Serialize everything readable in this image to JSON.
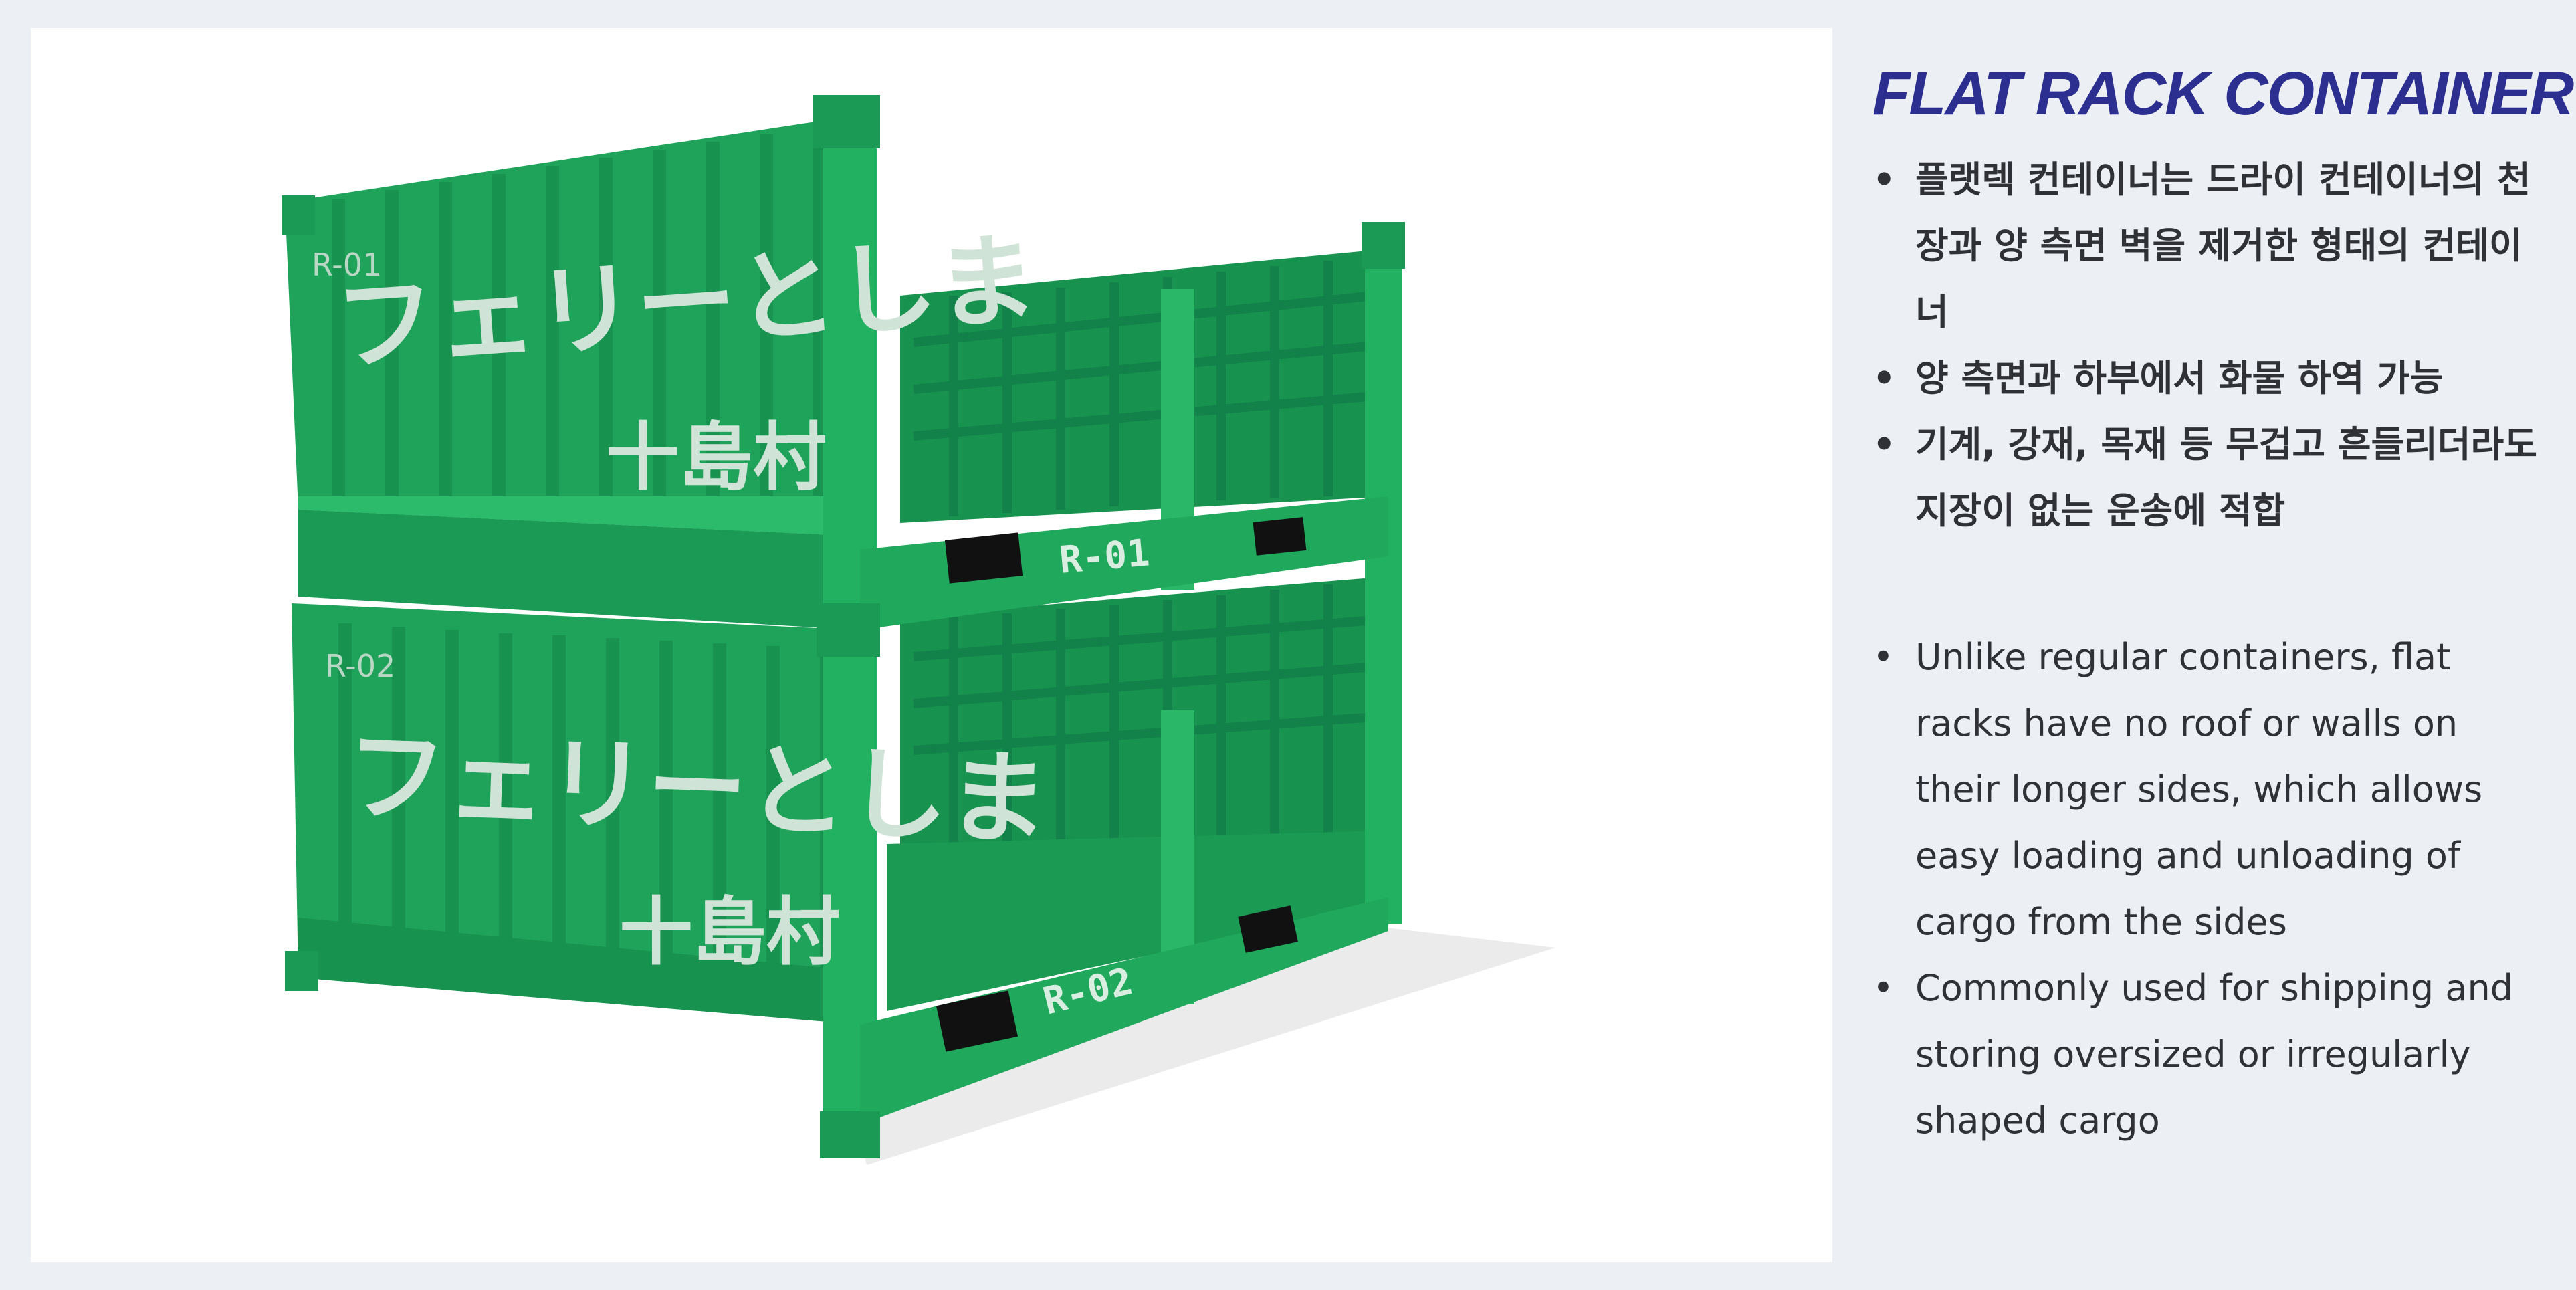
{
  "title": "FLAT RACK CONTAINER",
  "image": {
    "description_icon": "flat-rack-container-image",
    "top_container": {
      "id_small": "R-01",
      "japanese_text": "フェリーとしま",
      "village_text": "十島村",
      "end_code": "R-01"
    },
    "bottom_container": {
      "id_small": "R-02",
      "japanese_text": "フェリーとしま",
      "village_text": "十島村",
      "end_code": "R-02"
    },
    "colors": {
      "container": "#1fa35a",
      "container_dark": "#13824a",
      "container_light": "#36c274",
      "shadow": "#ececec"
    }
  },
  "korean_bullets": [
    "플랫렉 컨테이너는 드라이 컨테이너의 천장과 양 측면 벽을 제거한 형태의 컨테이너",
    "양 측면과 하부에서 화물 하역 가능",
    "기계, 강재, 목재 등 무겁고 흔들리더라도 지장이 없는 운송에 적합"
  ],
  "english_bullets": [
    "Unlike regular containers, flat racks have no roof or walls on their longer sides, which allows easy loading and unloading of cargo from the sides",
    "Commonly used for shipping and storing oversized or irregularly shaped cargo"
  ],
  "colors": {
    "title": "#2c2f8f",
    "text": "#2f3137",
    "background": "#eceff4",
    "panel": "#ffffff"
  }
}
